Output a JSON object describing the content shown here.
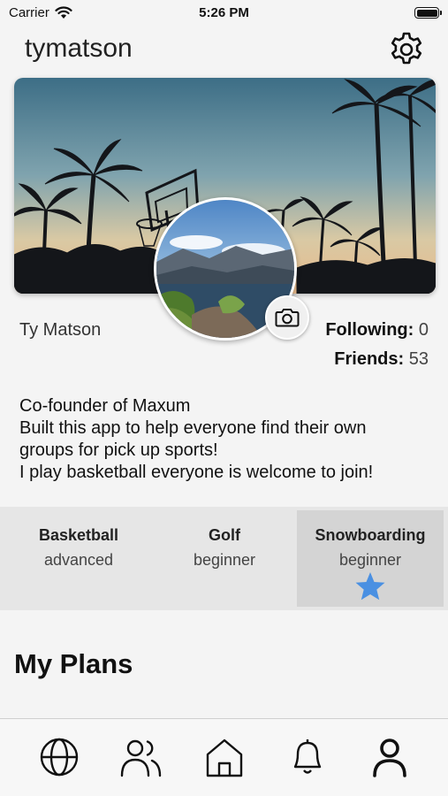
{
  "status": {
    "carrier": "Carrier",
    "time": "5:26 PM"
  },
  "header": {
    "username": "tymatson"
  },
  "profile": {
    "full_name": "Ty Matson",
    "following_label": "Following:",
    "following_count": "0",
    "friends_label": "Friends:",
    "friends_count": "53",
    "bio_lines": [
      "Co-founder of Maxum",
      "Built this app to help everyone find their own",
      "groups for pick up sports!",
      "I play basketball everyone is welcome to join!"
    ]
  },
  "sports": [
    {
      "name": "Basketball",
      "level": "advanced",
      "selected": false
    },
    {
      "name": "Golf",
      "level": "beginner",
      "selected": false
    },
    {
      "name": "Snowboarding",
      "level": "beginner",
      "selected": true
    }
  ],
  "sections": {
    "plans_title": "My Plans"
  },
  "tabbar": {
    "items": [
      "globe-icon",
      "friends-icon",
      "home-icon",
      "bell-icon",
      "profile-icon"
    ],
    "active": "profile-icon"
  },
  "colors": {
    "star": "#4a90e2",
    "background": "#f4f4f4",
    "sports_strip": "#e6e6e6",
    "selected_sport": "#d4d4d4"
  }
}
